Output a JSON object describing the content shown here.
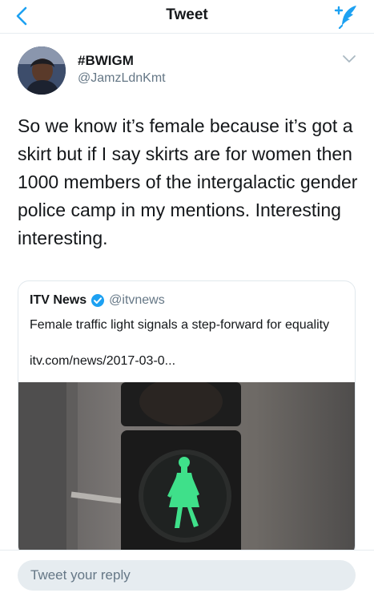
{
  "nav": {
    "title": "Tweet",
    "back_icon": "chevron-left-icon",
    "compose_icon": "compose-tweet-icon",
    "accent_color": "#1da1f2"
  },
  "tweet": {
    "display_name": "#BWIGM",
    "handle": "@JamzLdnKmt",
    "text": "So we know it’s female because it’s got a skirt but if I say skirts are for women then 1000 members of the intergalactic gender police camp in my mentions. Interesting interesting."
  },
  "card": {
    "source_name": "ITV News",
    "source_handle": "@itvnews",
    "verified_icon": "verified-badge-icon",
    "title": "Female traffic light signals a step-forward for equality",
    "url": "itv.com/news/2017-03-0..."
  },
  "reply": {
    "placeholder": "Tweet your reply"
  }
}
